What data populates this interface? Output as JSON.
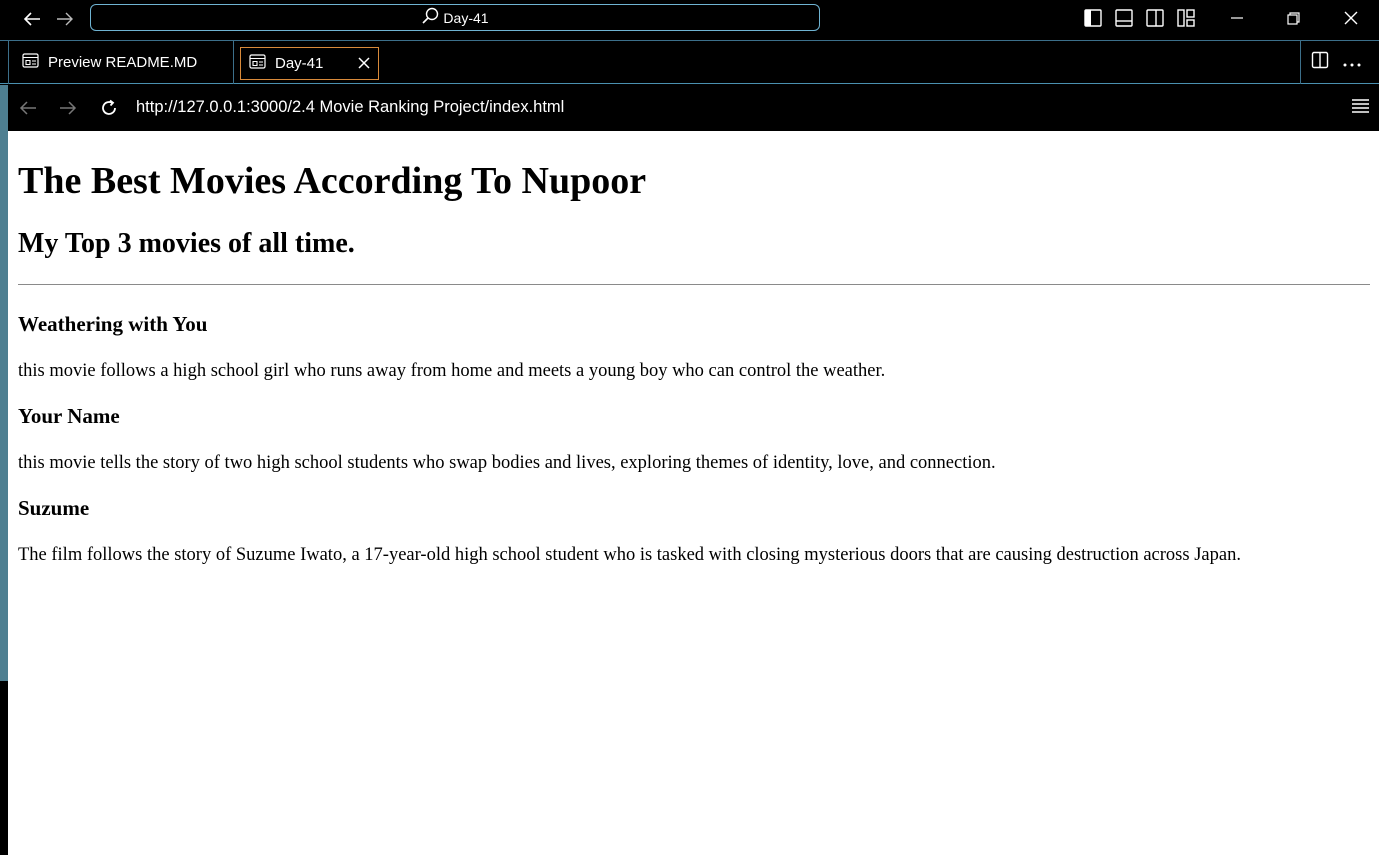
{
  "titlebar": {
    "command_center_text": "Day-41"
  },
  "tabs": [
    {
      "label": "Preview README.MD"
    },
    {
      "label": "Day-41"
    }
  ],
  "browser": {
    "url": "http://127.0.0.1:3000/2.4 Movie Ranking Project/index.html"
  },
  "page": {
    "title": "The Best Movies According To Nupoor",
    "subtitle": "My Top 3 movies of all time.",
    "movies": [
      {
        "name": "Weathering with You",
        "description": "this movie follows a high school girl who runs away from home and meets a young boy who can control the weather."
      },
      {
        "name": "Your Name",
        "description": "this movie tells the story of two high school students who swap bodies and lives, exploring themes of identity, love, and connection."
      },
      {
        "name": "Suzume",
        "description": "The film follows the story of Suzume Iwato, a 17-year-old high school student who is tasked with closing mysterious doors that are causing destruction across Japan."
      }
    ]
  },
  "colors": {
    "chrome_bg": "#000000",
    "accent_border": "#6fb3d2",
    "active_tab_border": "#d98a3a",
    "sidebar_teal": "#4e7f91"
  }
}
